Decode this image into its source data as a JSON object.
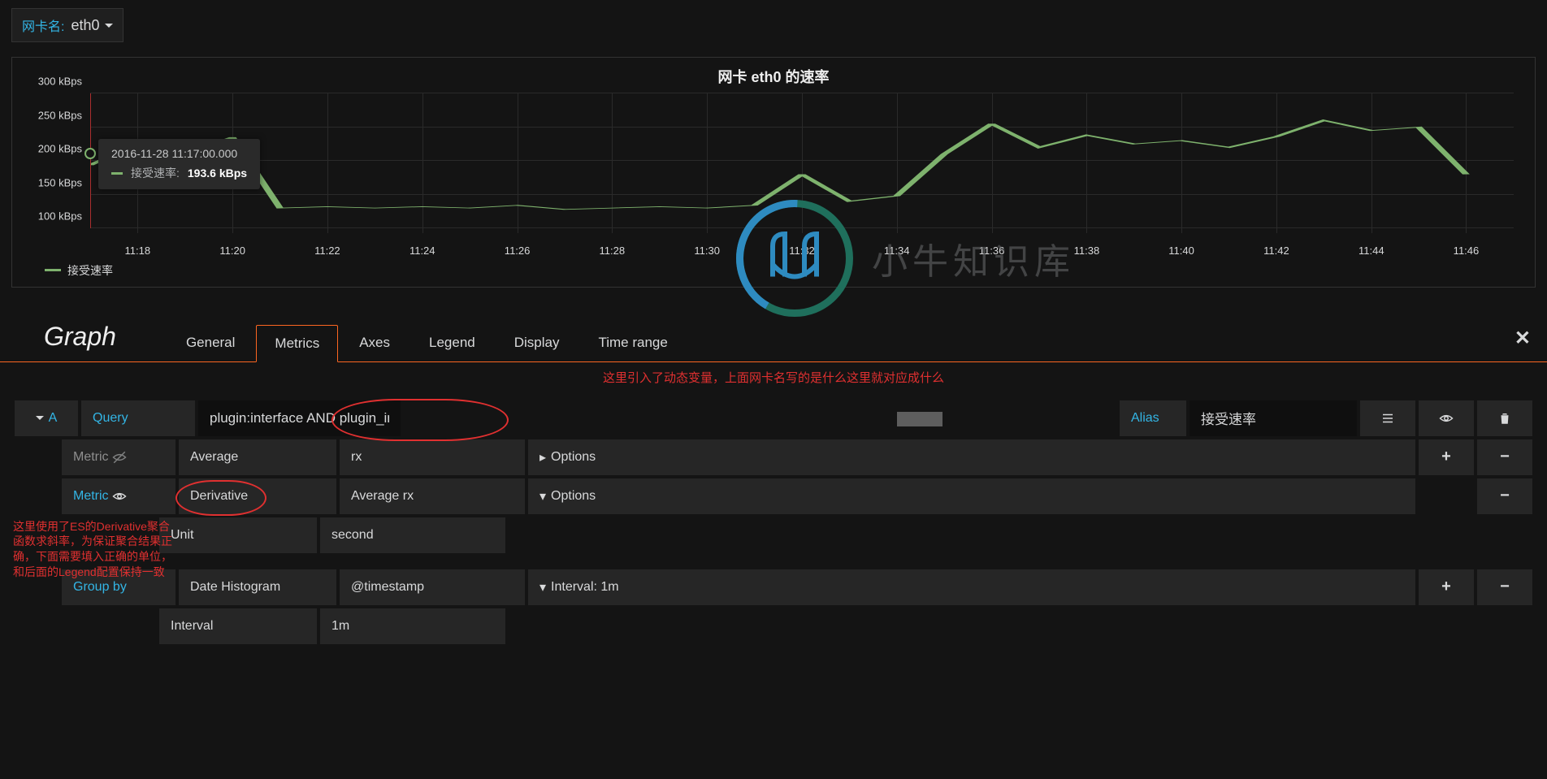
{
  "template": {
    "label": "网卡名:",
    "value": "eth0"
  },
  "panel": {
    "title": "网卡 eth0 的速率"
  },
  "chart_data": {
    "type": "line",
    "title": "网卡 eth0 的速率",
    "xlabel": "",
    "ylabel": "",
    "y_ticks": [
      "100 kBps",
      "150 kBps",
      "200 kBps",
      "250 kBps",
      "300 kBps"
    ],
    "ylim": [
      100,
      300
    ],
    "x_ticks": [
      "11:18",
      "11:20",
      "11:22",
      "11:24",
      "11:26",
      "11:28",
      "11:30",
      "11:32",
      "11:34",
      "11:36",
      "11:38",
      "11:40",
      "11:42",
      "11:44",
      "11:46"
    ],
    "series": [
      {
        "name": "接受速率",
        "color": "#7eb26d",
        "x": [
          "11:17",
          "11:18",
          "11:19",
          "11:20",
          "11:21",
          "11:22",
          "11:23",
          "11:24",
          "11:25",
          "11:26",
          "11:27",
          "11:28",
          "11:29",
          "11:30",
          "11:31",
          "11:32",
          "11:33",
          "11:34",
          "11:35",
          "11:36",
          "11:37",
          "11:38",
          "11:39",
          "11:40",
          "11:41",
          "11:42",
          "11:43",
          "11:44",
          "11:45",
          "11:46"
        ],
        "values": [
          193.6,
          225,
          210,
          235,
          130,
          132,
          130,
          132,
          130,
          134,
          128,
          130,
          132,
          130,
          134,
          180,
          140,
          148,
          210,
          255,
          220,
          238,
          225,
          230,
          220,
          236,
          260,
          245,
          250,
          180
        ]
      }
    ],
    "hover": {
      "timestamp": "2016-11-28 11:17:00.000",
      "series": "接受速率:",
      "value": "193.6 kBps",
      "x": "11:17"
    },
    "legend": [
      {
        "name": "接受速率",
        "color": "#7eb26d"
      }
    ]
  },
  "editor": {
    "title": "Graph",
    "tabs": [
      "General",
      "Metrics",
      "Axes",
      "Legend",
      "Display",
      "Time range"
    ],
    "active_tab": "Metrics"
  },
  "annotations": {
    "center": "这里引入了动态变量，上面网卡名写的是什么这里就对应成什么",
    "side": "这里使用了ES的Derivative聚合函数求斜率，为保证聚合结果正确，下面需要填入正确的单位，和后面的Legend配置保持一致"
  },
  "query_row": {
    "letter": "A",
    "label": "Query",
    "value": "plugin:interface AND plugin_instance:$interface AND collectd_type:if_octets AND host:",
    "alias_label": "Alias",
    "alias_value": "接受速率"
  },
  "metric1": {
    "label": "Metric",
    "agg": "Average",
    "field": "rx",
    "options": "Options"
  },
  "metric2": {
    "label": "Metric",
    "agg": "Derivative",
    "field": "Average rx",
    "options": "Options",
    "unit_label": "Unit",
    "unit_value": "second"
  },
  "groupby": {
    "label": "Group by",
    "agg": "Date Histogram",
    "field": "@timestamp",
    "options": "Interval: 1m",
    "interval_label": "Interval",
    "interval_value": "1m"
  },
  "watermark": "小牛知识库"
}
